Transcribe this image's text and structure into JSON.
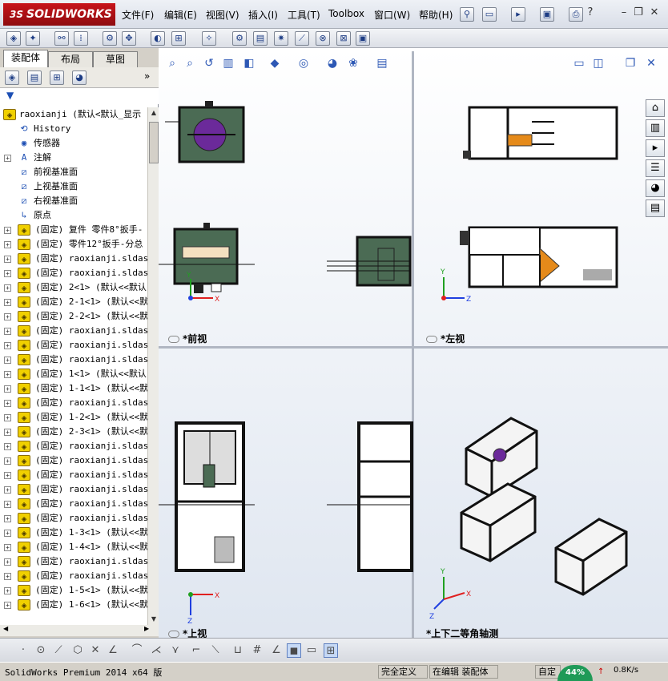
{
  "app": {
    "brand": "SOLIDWORKS",
    "brand_prefix": "3S"
  },
  "menu": [
    "文件(F)",
    "编辑(E)",
    "视图(V)",
    "插入(I)",
    "工具(T)",
    "Toolbox",
    "窗口(W)",
    "帮助(H)"
  ],
  "window_controls": {
    "minimize": "–",
    "restore": "❐",
    "close": "✕",
    "help": "?"
  },
  "tabs": [
    "装配体",
    "布局",
    "草图"
  ],
  "tree": {
    "root": "raoxianji  (默认<默认_显示",
    "fixed_items": [
      {
        "label": "History",
        "icon": "history-icon"
      },
      {
        "label": "传感器",
        "icon": "sensor-icon"
      },
      {
        "label": "注解",
        "icon": "annotation-icon",
        "expandable": true
      },
      {
        "label": "前视基准面",
        "icon": "plane-icon"
      },
      {
        "label": "上视基准面",
        "icon": "plane-icon"
      },
      {
        "label": "右视基准面",
        "icon": "plane-icon"
      },
      {
        "label": "原点",
        "icon": "origin-icon"
      }
    ],
    "components": [
      "(固定) 复件 零件8°扳手-",
      "(固定) 零件12°扳手-分总",
      "(固定) raoxianji.sldasm",
      "(固定) raoxianji.sldasm",
      "(固定) 2<1> (默认<<默认",
      "(固定) 2-1<1> (默认<<默",
      "(固定) 2-2<1> (默认<<默",
      "(固定) raoxianji.sldasm",
      "(固定) raoxianji.sldasm",
      "(固定) raoxianji.sldasm",
      "(固定) 1<1> (默认<<默认",
      "(固定) 1-1<1> (默认<<默",
      "(固定) raoxianji.sldasm",
      "(固定) 1-2<1> (默认<<默",
      "(固定) 2-3<1> (默认<<默",
      "(固定) raoxianji.sldasm",
      "(固定) raoxianji.sldasm",
      "(固定) raoxianji.sldasm",
      "(固定) raoxianji.sldasm",
      "(固定) raoxianji.sldasm",
      "(固定) raoxianji.sldasm",
      "(固定) 1-3<1> (默认<<默",
      "(固定) 1-4<1> (默认<<默",
      "(固定) raoxianji.sldasm",
      "(固定) raoxianji.sldasm",
      "(固定) 1-5<1> (默认<<默",
      "(固定) 1-6<1> (默认<<默"
    ]
  },
  "viewports": {
    "front": "*前视",
    "left": "*左视",
    "top": "*上视",
    "iso": "*上下二等角轴测"
  },
  "axis_labels": {
    "x": "X",
    "y": "Y",
    "z": "Z"
  },
  "status": {
    "version": "SolidWorks Premium 2014 x64 版",
    "definition": "完全定义",
    "editing": "在编辑 装配体",
    "custom": "自定",
    "net_percent": "44%",
    "net_speed": "0.8K/s"
  },
  "colors": {
    "brand_red": "#c8141a",
    "assembly_yellow": "#f0d000",
    "part_green": "#4b6b54",
    "part_purple": "#6b2a9a",
    "part_orange": "#e58a1a",
    "axis_red": "#e02020",
    "axis_green": "#20a020",
    "axis_blue": "#2040e0"
  }
}
